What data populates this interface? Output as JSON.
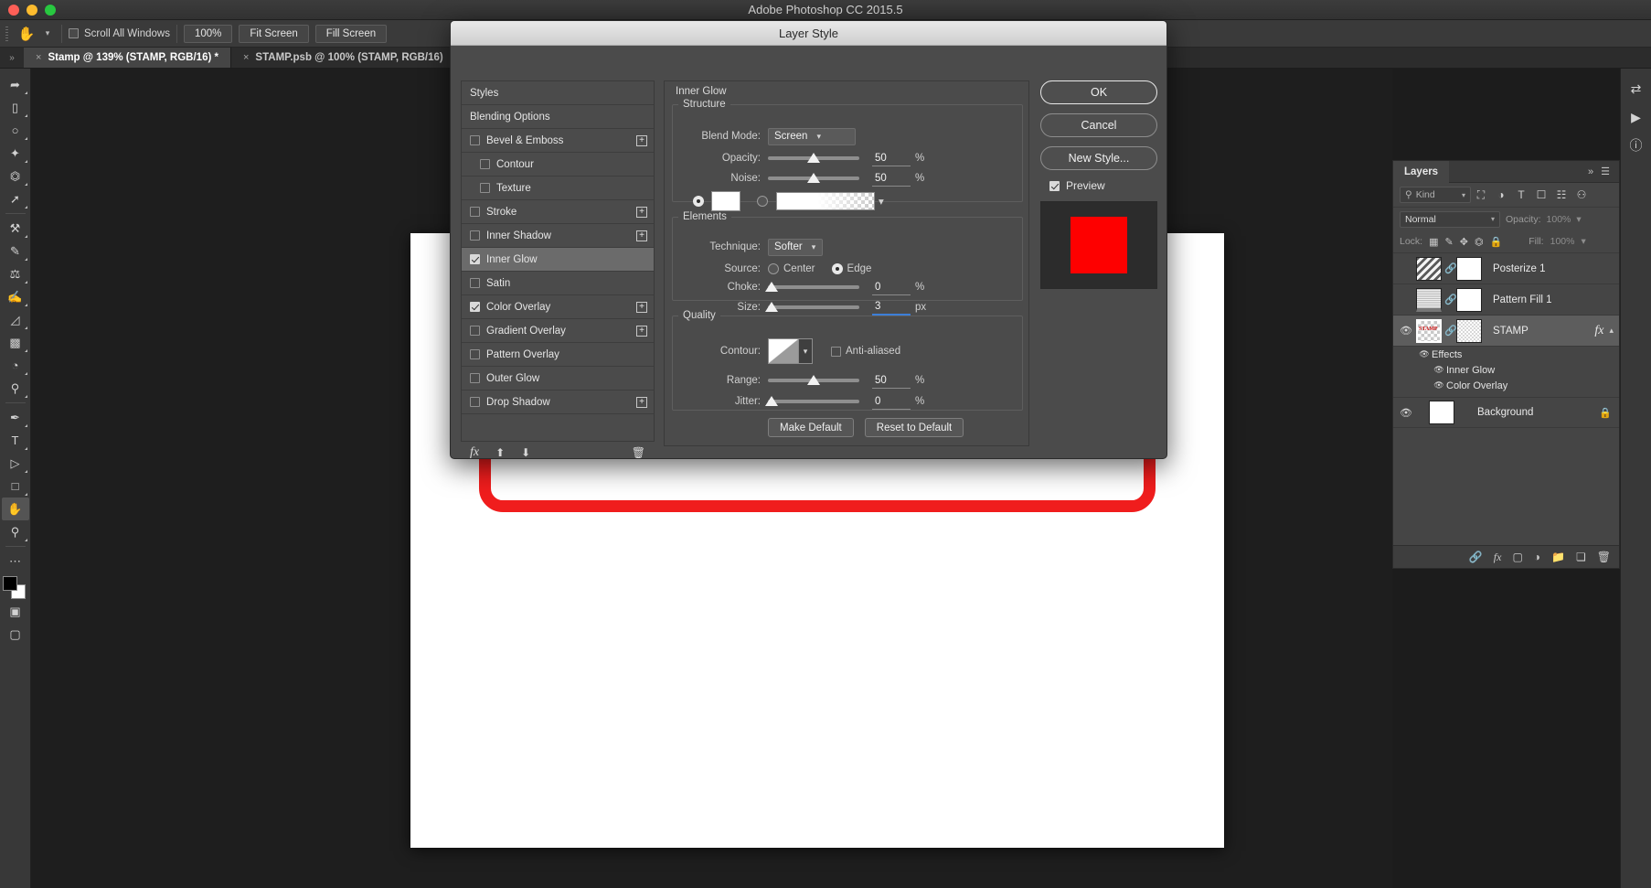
{
  "window": {
    "title": "Adobe Photoshop CC 2015.5"
  },
  "options_bar": {
    "tool_icon": "hand-tool-icon",
    "scroll_all_windows": {
      "label": "Scroll All Windows",
      "checked": false
    },
    "buttons": [
      {
        "label": "100%",
        "name": "zoom-100-button"
      },
      {
        "label": "Fit Screen",
        "name": "fit-screen-button"
      },
      {
        "label": "Fill Screen",
        "name": "fill-screen-button"
      }
    ]
  },
  "tabs": [
    {
      "label": "Stamp @ 139% (STAMP, RGB/16) *",
      "active": true
    },
    {
      "label": "STAMP.psb @ 100% (STAMP, RGB/16)",
      "active": false
    }
  ],
  "canvas": {
    "stamp_text": "STAMP",
    "stamp_color": "#f01d1d"
  },
  "dialog": {
    "title": "Layer Style",
    "styles": [
      {
        "label": "Styles",
        "type": "plain",
        "checked": null,
        "sub": false,
        "plus": false,
        "active": false
      },
      {
        "label": "Blending Options",
        "type": "plain",
        "checked": null,
        "sub": false,
        "plus": false,
        "active": false
      },
      {
        "label": "Bevel & Emboss",
        "type": "check",
        "checked": false,
        "sub": false,
        "plus": true,
        "active": false
      },
      {
        "label": "Contour",
        "type": "check",
        "checked": false,
        "sub": true,
        "plus": false,
        "active": false
      },
      {
        "label": "Texture",
        "type": "check",
        "checked": false,
        "sub": true,
        "plus": false,
        "active": false
      },
      {
        "label": "Stroke",
        "type": "check",
        "checked": false,
        "sub": false,
        "plus": true,
        "active": false
      },
      {
        "label": "Inner Shadow",
        "type": "check",
        "checked": false,
        "sub": false,
        "plus": true,
        "active": false
      },
      {
        "label": "Inner Glow",
        "type": "check",
        "checked": true,
        "sub": false,
        "plus": false,
        "active": true
      },
      {
        "label": "Satin",
        "type": "check",
        "checked": false,
        "sub": false,
        "plus": false,
        "active": false
      },
      {
        "label": "Color Overlay",
        "type": "check",
        "checked": true,
        "sub": false,
        "plus": true,
        "active": false
      },
      {
        "label": "Gradient Overlay",
        "type": "check",
        "checked": false,
        "sub": false,
        "plus": true,
        "active": false
      },
      {
        "label": "Pattern Overlay",
        "type": "check",
        "checked": false,
        "sub": false,
        "plus": false,
        "active": false
      },
      {
        "label": "Outer Glow",
        "type": "check",
        "checked": false,
        "sub": false,
        "plus": false,
        "active": false
      },
      {
        "label": "Drop Shadow",
        "type": "check",
        "checked": false,
        "sub": false,
        "plus": true,
        "active": false
      }
    ],
    "section_title": "Inner Glow",
    "structure": {
      "legend": "Structure",
      "blend_mode_label": "Blend Mode:",
      "blend_mode_value": "Screen",
      "opacity_label": "Opacity:",
      "opacity_value": "50",
      "opacity_unit": "%",
      "noise_label": "Noise:",
      "noise_value": "50",
      "noise_unit": "%",
      "fill_type": "color",
      "color_value": "#ffffff"
    },
    "elements": {
      "legend": "Elements",
      "technique_label": "Technique:",
      "technique_value": "Softer",
      "source_label": "Source:",
      "source_center_label": "Center",
      "source_edge_label": "Edge",
      "source_value": "Edge",
      "choke_label": "Choke:",
      "choke_value": "0",
      "choke_unit": "%",
      "size_label": "Size:",
      "size_value": "3",
      "size_unit": "px",
      "size_editing": true
    },
    "quality": {
      "legend": "Quality",
      "contour_label": "Contour:",
      "antialiased_label": "Anti-aliased",
      "antialiased_checked": false,
      "range_label": "Range:",
      "range_value": "50",
      "range_unit": "%",
      "jitter_label": "Jitter:",
      "jitter_value": "0",
      "jitter_unit": "%"
    },
    "footer_buttons": [
      {
        "label": "Make Default",
        "name": "make-default-button"
      },
      {
        "label": "Reset to Default",
        "name": "reset-to-default-button"
      }
    ],
    "actions": [
      {
        "label": "OK",
        "name": "ok-button",
        "primary": true
      },
      {
        "label": "Cancel",
        "name": "cancel-button",
        "primary": false
      },
      {
        "label": "New Style...",
        "name": "new-style-button",
        "primary": false
      }
    ],
    "preview": {
      "label": "Preview",
      "checked": true,
      "swatch_color": "#fe0000"
    }
  },
  "layers_panel": {
    "tab_label": "Layers",
    "filter": {
      "kind_label": "Kind"
    },
    "blend_mode": "Normal",
    "opacity_label": "Opacity:",
    "opacity_value": "100%",
    "lock_label": "Lock:",
    "fill_label": "Fill:",
    "fill_value": "100%",
    "rows": [
      {
        "name": "Posterize 1",
        "visible": false,
        "selected": false,
        "thumb": "adj",
        "linked": true,
        "fx": false,
        "locked": false
      },
      {
        "name": "Pattern Fill 1",
        "visible": false,
        "selected": false,
        "thumb": "pattern",
        "linked": true,
        "fx": false,
        "locked": false
      },
      {
        "name": "STAMP",
        "visible": true,
        "selected": true,
        "thumb": "checker",
        "linked": true,
        "fx": true,
        "locked": false
      },
      {
        "name": "Background",
        "visible": true,
        "selected": false,
        "thumb": "plain",
        "linked": false,
        "fx": false,
        "locked": true
      }
    ],
    "effects": {
      "label": "Effects",
      "items": [
        "Inner Glow",
        "Color Overlay"
      ]
    }
  }
}
